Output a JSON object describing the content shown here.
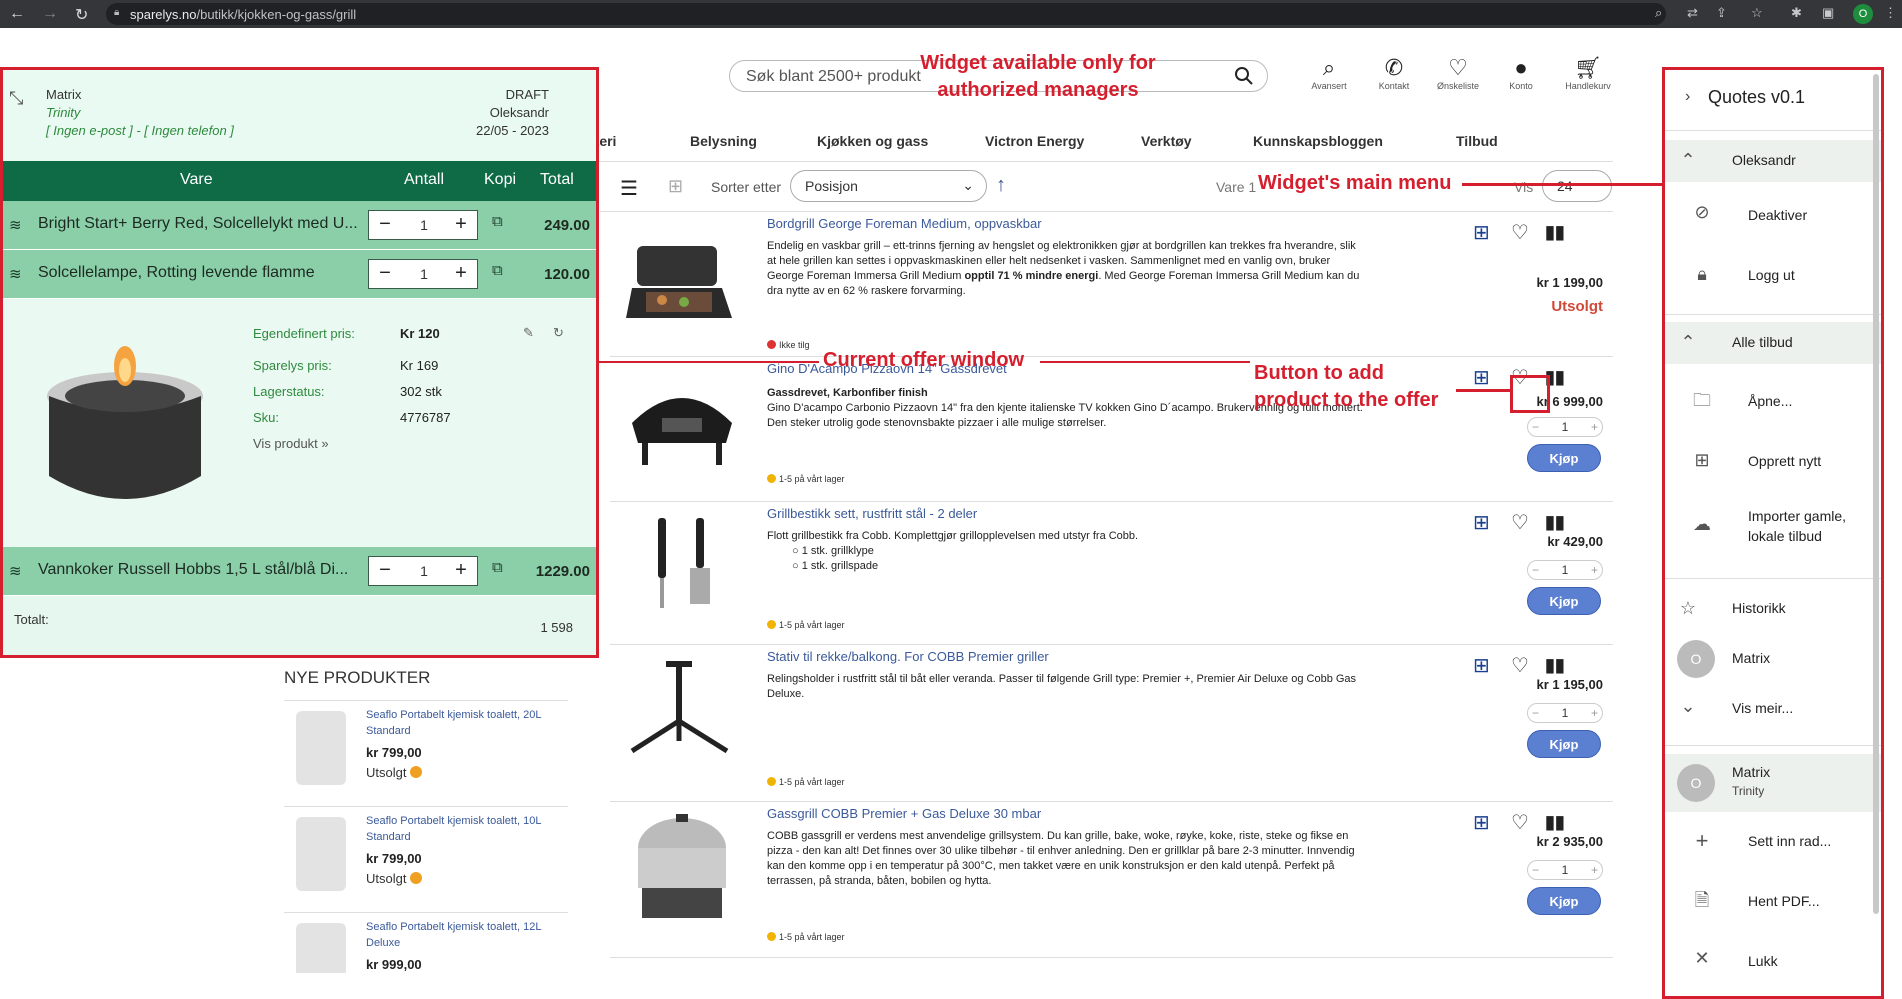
{
  "browser": {
    "url_domain": "sparelys.no",
    "url_path": "/butikk/kjokken-og-gass/grill",
    "profile_initial": "O"
  },
  "header": {
    "search_placeholder": "Søk blant 2500+ produkt",
    "icons": [
      {
        "label": "Avansert",
        "icon": "search-icon"
      },
      {
        "label": "Kontakt",
        "icon": "phone-icon"
      },
      {
        "label": "Ønskeliste",
        "icon": "heart-icon"
      },
      {
        "label": "Konto",
        "icon": "user-icon"
      },
      {
        "label": "Handlekurv",
        "icon": "cart-icon"
      }
    ]
  },
  "menu": [
    "tteri",
    "Belysning",
    "Kjøkken og gass",
    "Victron Energy",
    "Verktøy",
    "Kunnskapsbloggen",
    "Tilbud"
  ],
  "toolbar": {
    "sort_label": "Sorter etter",
    "sort_value": "Posisjon",
    "items_label": "Vare 1",
    "show_label": "Vis",
    "show_value": "24"
  },
  "products": [
    {
      "title": "Bordgrill George Foreman Medium, oppvaskbar",
      "desc_pre": "Endelig en vaskbar grill – ett-trinns fjerning av hengslet og elektronikken gjør at bordgrillen kan trekkes fra hverandre, slik at hele grillen kan settes i oppvaskmaskinen eller helt nedsenket i vasken. Sammenlignet med en vanlig ovn, bruker George Foreman Immersa Grill Medium ",
      "desc_bold": "opptil 71 % mindre energi",
      "desc_post": ". Med George Foreman Immersa Grill Medium kan du dra nytte av en 62 % raskere forvarming.",
      "stock": "Ikke tilg",
      "price": "kr 1 199,00",
      "status": "Utsolgt"
    },
    {
      "title": "Gino D'Acampo Pizzaovn 14\" Gassdrevet",
      "subtitle": "Gassdrevet, Karbonfiber finish",
      "desc": "Gino D'acampo Carbonio Pizzaovn 14\" fra den kjente italienske TV kokken Gino D´acampo. Brukervennlig og fullt montert. Den steker utrolig gode stenovnsbakte pizzaer i alle mulige størrelser.",
      "stock": "1-5 på vårt lager",
      "price": "kr 6 999,00",
      "qty": "1",
      "buy": "Kjøp"
    },
    {
      "title": "Grillbestikk sett, rustfritt stål - 2 deler",
      "desc": "Flott grillbestikk fra Cobb. Komplettgjør grillopplevelsen med utstyr fra Cobb.",
      "bullets": [
        "1 stk. grillklype",
        "1 stk. grillspade"
      ],
      "stock": "1-5 på vårt lager",
      "price": "kr 429,00",
      "qty": "1",
      "buy": "Kjøp"
    },
    {
      "title": "Stativ til rekke/balkong. For COBB Premier griller",
      "desc": "Relingsholder i rustfritt stål til båt eller veranda. Passer til følgende Grill type: Premier +, Premier Air Deluxe og Cobb Gas Deluxe.",
      "stock": "1-5 på vårt lager",
      "price": "kr 1 195,00",
      "qty": "1",
      "buy": "Kjøp"
    },
    {
      "title": "Gassgrill COBB Premier + Gas Deluxe 30 mbar",
      "desc": "COBB gassgrill er verdens mest anvendelige grillsystem. Du kan grille, bake, woke, røyke, koke, riste, steke og fikse en pizza - den kan alt! Det finnes over 30 ulike tilbehør - til enhver anledning. Den er grillklar på bare 2-3 minutter. Innvendig kan den komme opp i en temperatur på 300°C, men takket være en unik konstruksjon er den kald utenpå. Perfekt på terrassen, på stranda, båten, bobilen og hytta.",
      "stock": "1-5 på vårt lager",
      "price": "kr 2 935,00",
      "qty": "1",
      "buy": "Kjøp"
    }
  ],
  "new_products": {
    "heading": "NYE PRODUKTER",
    "items": [
      {
        "title": "Seaflo Portabelt kjemisk toalett, 20L Standard",
        "price": "kr 799,00",
        "status": "Utsolgt"
      },
      {
        "title": "Seaflo Portabelt kjemisk toalett, 10L Standard",
        "price": "kr 799,00",
        "status": "Utsolgt"
      },
      {
        "title": "Seaflo Portabelt kjemisk toalett, 12L Deluxe",
        "price": "kr 999,00",
        "status": ""
      }
    ]
  },
  "offer": {
    "company": "Matrix",
    "customer": "Trinity",
    "contact": "[ Ingen e-post ] - [ Ingen telefon ]",
    "status": "DRAFT",
    "manager": "Oleksandr",
    "date": "22/05 - 2023",
    "columns": {
      "item": "Vare",
      "qty": "Antall",
      "copy": "Kopi",
      "total": "Total"
    },
    "rows": [
      {
        "name": "Bright Start+ Berry Red, Solcellelykt med U...",
        "qty": "1",
        "total": "249.00"
      },
      {
        "name": "Solcellelampe, Rotting levende flamme",
        "qty": "1",
        "total": "120.00"
      },
      {
        "name": "Vannkoker Russell Hobbs 1,5 L stål/blå Di...",
        "qty": "1",
        "total": "1229.00"
      }
    ],
    "detail": {
      "custom_price_label": "Egendefinert pris:",
      "custom_price": "Kr  120",
      "sparelys_label": "Sparelys pris:",
      "sparelys_price": "Kr  169",
      "stock_label": "Lagerstatus:",
      "stock_value": "302 stk",
      "sku_label": "Sku:",
      "sku_value": "4776787",
      "link": "Vis produkt »"
    },
    "total_label": "Totalt:",
    "total_value": "1 598"
  },
  "widget": {
    "title": "Quotes v0.1",
    "user": "Oleksandr",
    "deactivate": "Deaktiver",
    "logout": "Logg ut",
    "all_offers": "Alle tilbud",
    "open": "Åpne...",
    "create": "Opprett nytt",
    "import": "Importer gamle, lokale tilbud",
    "history": "Historikk",
    "recent_name": "Matrix",
    "recent_initial": "O",
    "show_more": "Vis meir...",
    "active_name": "Matrix",
    "active_sub": "Trinity",
    "active_initial": "O",
    "insert_row": "Sett inn rad...",
    "get_pdf": "Hent PDF...",
    "close": "Lukk"
  },
  "annotations": {
    "widget_authorized": "Widget available only for authorized managers",
    "main_menu": "Widget's main menu",
    "offer_window": "Current offer window",
    "add_button": "Button to add product to the offer"
  }
}
